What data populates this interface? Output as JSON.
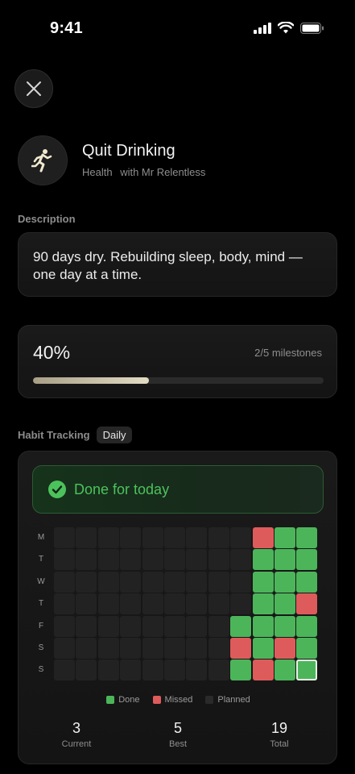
{
  "status": {
    "time": "9:41"
  },
  "habit": {
    "title": "Quit Drinking",
    "category": "Health",
    "coach": "with Mr Relentless",
    "icon": "running-person-icon"
  },
  "description": {
    "label": "Description",
    "text": "90 days dry. Rebuilding sleep, body, mind — one day at a time."
  },
  "progress": {
    "percent_label": "40%",
    "milestones_label": "2/5 milestones",
    "fraction": 0.4
  },
  "tracking": {
    "label": "Habit Tracking",
    "frequency": "Daily",
    "banner": "Done for today",
    "day_labels": [
      "M",
      "T",
      "W",
      "T",
      "F",
      "S",
      "S"
    ],
    "weeks": 12,
    "cells": [
      [
        "p",
        "p",
        "p",
        "p",
        "p",
        "p",
        "p",
        "p",
        "p",
        "m",
        "d",
        "d"
      ],
      [
        "p",
        "p",
        "p",
        "p",
        "p",
        "p",
        "p",
        "p",
        "p",
        "d",
        "d",
        "d"
      ],
      [
        "p",
        "p",
        "p",
        "p",
        "p",
        "p",
        "p",
        "p",
        "p",
        "d",
        "d",
        "d"
      ],
      [
        "p",
        "p",
        "p",
        "p",
        "p",
        "p",
        "p",
        "p",
        "p",
        "d",
        "d",
        "m"
      ],
      [
        "p",
        "p",
        "p",
        "p",
        "p",
        "p",
        "p",
        "p",
        "d",
        "d",
        "d",
        "d"
      ],
      [
        "p",
        "p",
        "p",
        "p",
        "p",
        "p",
        "p",
        "p",
        "m",
        "d",
        "m",
        "d"
      ],
      [
        "p",
        "p",
        "p",
        "p",
        "p",
        "p",
        "p",
        "p",
        "d",
        "m",
        "d",
        "d"
      ]
    ],
    "today": {
      "row": 6,
      "col": 11
    },
    "legend": {
      "done": "Done",
      "missed": "Missed",
      "planned": "Planned"
    },
    "colors": {
      "done": "#4cb55a",
      "missed": "#de5b5b",
      "planned": "#2a2a2a",
      "accent": "#4cc25c"
    }
  },
  "stats": {
    "current": {
      "value": "3",
      "label": "Current"
    },
    "best": {
      "value": "5",
      "label": "Best"
    },
    "total": {
      "value": "19",
      "label": "Total"
    }
  }
}
